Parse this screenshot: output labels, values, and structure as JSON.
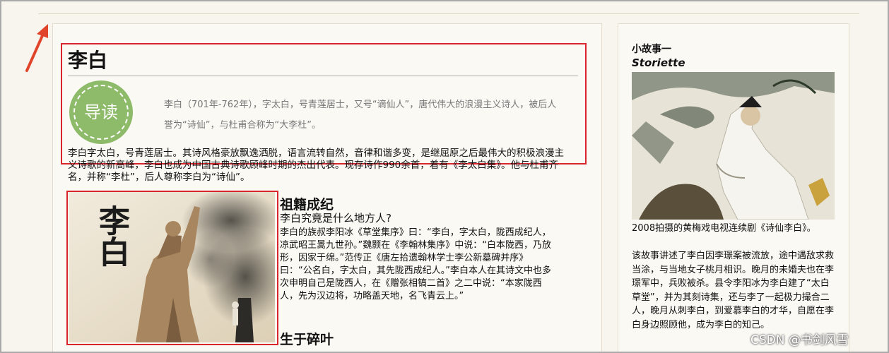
{
  "article": {
    "title": "李白",
    "badge_label": "导读",
    "intro": "李白（701年-762年），字太白，号青莲居士，又号“谪仙人”，唐代伟大的浪漫主义诗人，被后人誉为“诗仙”，与杜甫合称为“大李杜”。",
    "bio": "李白字太白，号青莲居士。其诗风格豪放飘逸洒脱，语言流转自然，音律和谐多变，是继屈原之后最伟大的积极浪漫主义诗歌的新高峰，李白也成为中国古典诗歌顾峰时期的杰出代表。现存诗作990余首，着有《李太白集》。他与杜甫齐名，并称“李杜”，后人尊称李白为“诗仙”。",
    "portrait_calligraphy": "李白",
    "section1": {
      "heading": "祖籍成纪",
      "question": "李白究竟是什么地方人?",
      "text": "李白的族叔李阳冰《草堂集序》曰：“李白，字太白，陇西成纪人，凉武昭王暠九世孙。”魏颢在《李翰林集序》中说：“白本陇西，乃放形，因家于绵。”范传正《唐左拾遗翰林学士李公新墓碑并序》曰：“公名白，字太白，其先陇西成纪人。”李白本人在其诗文中也多次申明自己是陇西人，在《赠张相镐二首》之二中说：“本家陇西人，先为汉边将，功略盖天地，名飞青云上。”"
    },
    "section2": {
      "heading": "生于碎叶"
    }
  },
  "sidebar": {
    "heading": "小故事一",
    "subheading": "Storiette",
    "caption": "2008拍摄的黄梅戏电视连续剧《诗仙李白》。",
    "story": "该故事讲述了李白因李璟案被流放，途中遇敌求救当涂，与当地女子桃月相识。晚月的未婚夫也在李璟军中，兵败被杀。县令李阳冰为李白建了“太白草堂”，并为其刻诗集，还与李了一起极力撮合二人，晚月从刺李白，到爱慕李白的才华，自愿在李白身边照顾他，成为李白的知己。"
  },
  "watermark": "CSDN @书剑风雪",
  "colors": {
    "highlight_border": "#d9262c",
    "badge_green": "#8dbb69",
    "arrow": "#e0442a",
    "page_bg": "#f8f5ee"
  }
}
